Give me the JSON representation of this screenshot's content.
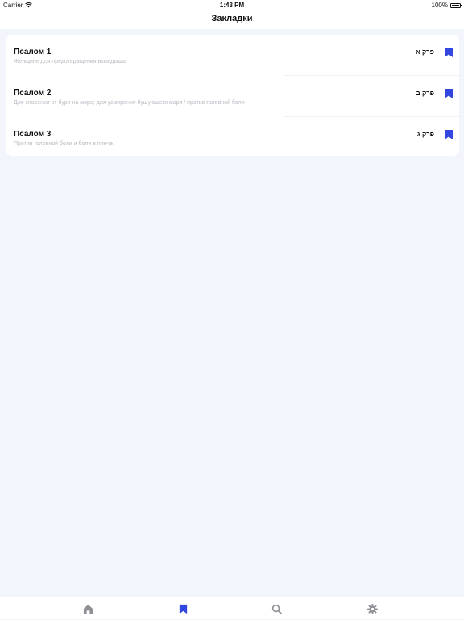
{
  "status_bar": {
    "carrier": "Carrier",
    "time": "1:43 PM",
    "battery": "100%",
    "battery_level": 1.0
  },
  "nav": {
    "title": "Закладки"
  },
  "bookmarks": [
    {
      "title": "Псалом 1",
      "subtitle": "Женщине для предотвращения выкидыша.",
      "hebrew": "פרק א",
      "icon": "bookmark-icon"
    },
    {
      "title": "Псалом 2",
      "subtitle": "Для спасения от бури на море; для усмирения бушующего моря / против головной боли",
      "hebrew": "פרק ב",
      "icon": "bookmark-icon"
    },
    {
      "title": "Псалом 3",
      "subtitle": "Против головной боли и боли в плече.",
      "hebrew": "פרק ג",
      "icon": "bookmark-icon"
    }
  ],
  "tab_bar": {
    "selected": "bookmarks",
    "items": [
      {
        "id": "home",
        "icon": "home-icon"
      },
      {
        "id": "bookmarks",
        "icon": "bookmark-icon"
      },
      {
        "id": "search",
        "icon": "search-icon"
      },
      {
        "id": "settings",
        "icon": "gear-icon"
      }
    ]
  },
  "colors": {
    "accent": "#3347e0",
    "background": "#f3f5fd",
    "inactive_icon": "#8e9096",
    "subtitle_text": "#b7bac2"
  }
}
